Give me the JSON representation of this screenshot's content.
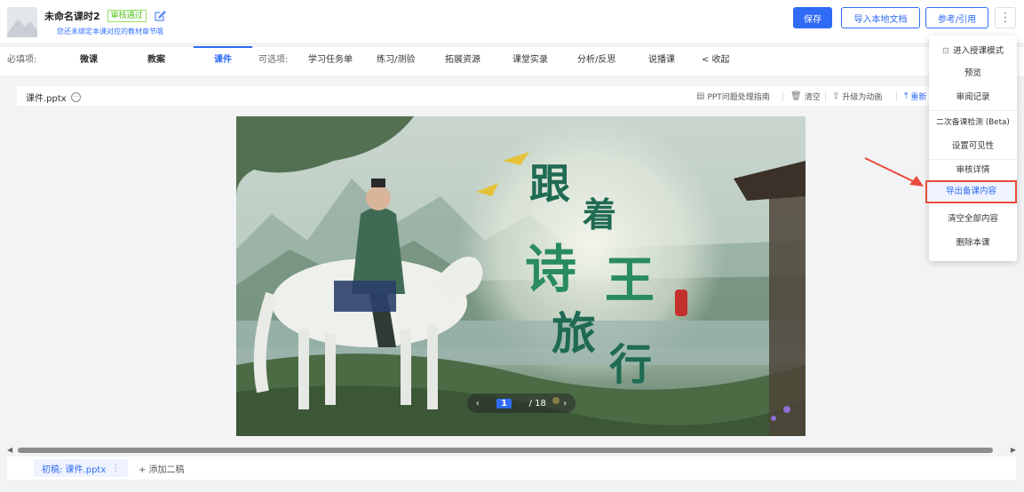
{
  "header": {
    "title": "未命名课时2",
    "status_badge": "审核通过",
    "subtitle": "您还未绑定本课对应的教材章节哦",
    "save": "保存",
    "import_doc": "导入本地文档",
    "reference": "参考/引用",
    "more": "⋮"
  },
  "tabs": {
    "required_label": "必填项:",
    "microlesson": "微课",
    "lesson_plan": "教案",
    "courseware": "课件",
    "optional_label": "可选项:",
    "task_list": "学习任务单",
    "practice": "练习/测验",
    "extension": "拓展资源",
    "recording": "课堂实录",
    "reflection": "分析/反思",
    "talk": "说播课",
    "collapse": "< 收起"
  },
  "filebar": {
    "filename": "课件.pptx",
    "ppt_guide": "PPT问题处理指南",
    "clear": "清空",
    "upgrade": "升级为动画",
    "reupload": "重新"
  },
  "slide": {
    "calligraphy": [
      "跟",
      "着",
      "诗",
      "王",
      "旅",
      "行"
    ],
    "current_page": "1",
    "total_pages": "/ 18"
  },
  "drafts": {
    "first_draft": "初稿: 课件.pptx",
    "more": "⋮",
    "add_draft": "+ 添加二稿"
  },
  "menu": {
    "items": [
      "进入授课模式",
      "预览",
      "审阅记录",
      "二次备课检测 (Beta)",
      "设置可见性",
      "审核详情",
      "导出备课内容",
      "清空全部内容",
      "删除本课"
    ]
  },
  "colors": {
    "accent": "#2f6bf5",
    "badge_green": "#52c41a",
    "highlight_red": "#e74c3c"
  }
}
